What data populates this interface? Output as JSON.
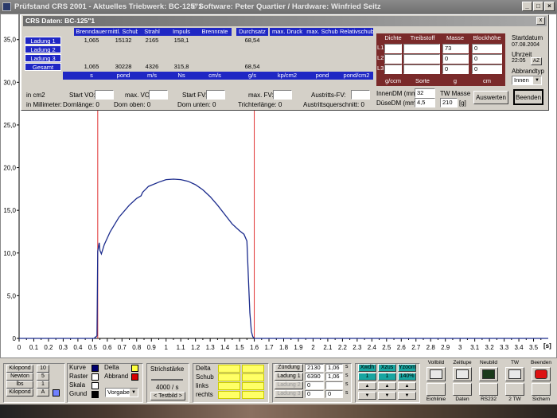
{
  "window": {
    "title_left": "Prüfstand CRS 2001 - Aktuelles Triebwerk: BC-125\"1",
    "title_right": "© Software: Peter Quartier / Hardware: Winfried Seitz",
    "min_glyph": "_",
    "max_glyph": "□",
    "close_glyph": "×"
  },
  "crs": {
    "title": "CRS Daten: BC-125\"1",
    "close_glyph": "x",
    "columns": [
      "Brenndauer",
      "mittl. Schub",
      "Strahl",
      "Impuls",
      "Brennrate",
      "Durchsatz",
      "max. Druck",
      "max. Schub",
      "Relativschub"
    ],
    "rows": [
      {
        "label": "Ladung 1",
        "values": [
          "1,065",
          "15132",
          "2165",
          "158,1",
          "",
          "68,54",
          "",
          "",
          ""
        ]
      },
      {
        "label": "Ladung 2",
        "values": [
          "",
          "",
          "",
          "",
          "",
          "",
          "",
          "",
          ""
        ]
      },
      {
        "label": "Ladung 3",
        "values": [
          "",
          "",
          "",
          "",
          "",
          "",
          "",
          "",
          ""
        ]
      },
      {
        "label": "Gesamt",
        "values": [
          "1,065",
          "30228",
          "4326",
          "315,8",
          "",
          "68,54",
          "",
          "",
          ""
        ]
      }
    ],
    "units": [
      "s",
      "pond",
      "m/s",
      "Ns",
      "cm/s",
      "g/s",
      "kp/cm2",
      "pond",
      "pond/cm2"
    ],
    "in_cm2": "in cm2",
    "in_mm": "in Millimeter:",
    "start_vo": "Start VO:",
    "max_vo": "max. VO:",
    "start_fv": "Start FV:",
    "max_fv": "max. FV:",
    "austritts_fv": "Austritts-FV:",
    "dornlaenge": "Dornlänge: 0",
    "dorn_oben": "Dorn oben: 0",
    "dorn_unten": "Dorn unten: 0",
    "trichterlaenge": "Trichterlänge: 0",
    "austrittsquerschnitt": "Austrittsquerschnitt: 0",
    "charge": {
      "headers": [
        "Dichte",
        "Treibstoff",
        "Masse",
        "Blockhöhe"
      ],
      "rows": [
        {
          "label": "L1",
          "dichte": "",
          "treibstoff": "",
          "masse": "73",
          "blockhoehe": "0"
        },
        {
          "label": "L2",
          "dichte": "",
          "treibstoff": "",
          "masse": "0",
          "blockhoehe": "0"
        },
        {
          "label": "L3",
          "dichte": "",
          "treibstoff": "",
          "masse": "0",
          "blockhoehe": "0"
        }
      ],
      "units": [
        "g/ccm",
        "Sorte",
        "g",
        "cm"
      ]
    },
    "innen_dm_label": "InnenDM (mm)",
    "innen_dm": "32",
    "duese_dm_label": "DüseDM (mm)",
    "duese_dm": "4,5",
    "tw_masse_label": "TW Masse",
    "tw_masse": "210",
    "tw_masse_unit": "[g]",
    "startdatum_label": "Startdatum",
    "startdatum": "07.08.2004",
    "uhrzeit_label": "Uhrzeit",
    "uhrzeit": "22:05",
    "az_button": "AZ",
    "abbrand_label": "Abbrandtyp",
    "abbrand_value": "Innen",
    "auswerten_button": "Auswerten",
    "beenden_button": "Beenden"
  },
  "chart_data": {
    "type": "line",
    "xlabel": "[s]",
    "x_ticks": [
      "0",
      "0.1",
      "0.2",
      "0.3",
      "0.4",
      "0.5",
      "0.6",
      "0.7",
      "0.8",
      "0.9",
      "1",
      "1.1",
      "1.2",
      "1.3",
      "1.4",
      "1.5",
      "1.6",
      "1.7",
      "1.8",
      "1.9",
      "2",
      "2.1",
      "2.2",
      "2.3",
      "2.4",
      "2.5",
      "2.6",
      "2.7",
      "2.8",
      "2.9",
      "3",
      "3.1",
      "3.2",
      "3.3",
      "3.4",
      "3.5"
    ],
    "y_ticks": [
      "0",
      "5,0",
      "10,0",
      "15,0",
      "20,0",
      "25,0",
      "30,0",
      "35,0"
    ],
    "xlim": [
      0,
      3.6
    ],
    "ylim": [
      0,
      36
    ],
    "marker_lines_x": [
      0.535,
      1.6
    ],
    "marker_color": "#e03030",
    "line_color": "#1a2a8c",
    "series": [
      {
        "x": [
          0,
          0.51,
          0.53,
          0.535,
          0.545,
          0.55,
          0.56,
          0.58,
          0.62,
          0.68,
          0.75,
          0.8,
          0.83,
          0.84,
          0.88,
          0.95,
          1.0,
          1.05,
          1.1,
          1.15,
          1.2,
          1.25,
          1.3,
          1.35,
          1.4,
          1.45,
          1.5,
          1.53,
          1.55,
          1.56,
          1.57,
          1.58,
          1.59,
          1.6,
          1.62,
          1.65,
          3.6
        ],
        "y": [
          0,
          0,
          0.3,
          10.2,
          11.2,
          10.3,
          9.9,
          11.0,
          12.5,
          14.2,
          15.6,
          16.4,
          16.7,
          17.1,
          17.8,
          18.3,
          18.6,
          18.65,
          18.6,
          18.4,
          18.0,
          17.4,
          16.6,
          15.6,
          14.5,
          13.4,
          12.6,
          12.2,
          11.4,
          7.0,
          3.0,
          0.8,
          0.2,
          0,
          0,
          0,
          0
        ]
      }
    ]
  },
  "bottom": {
    "units": [
      "Kilopond",
      "Newton",
      "lbs",
      "Kilopond"
    ],
    "unit_values": [
      "10",
      "5",
      "1",
      "A"
    ],
    "legend_labels": [
      "Kurve",
      "Raster",
      "Skala",
      "Grund"
    ],
    "legend_colors": [
      "#00006e",
      "#ffffff",
      "#ffffff",
      "#000000"
    ],
    "legend2_labels": [
      "Delta",
      "Abbrand"
    ],
    "legend2_colors": [
      "#ffff40",
      "#d40000"
    ],
    "vorgabe": "Vorgabe",
    "strichstaerke_label": "Strichstärke",
    "strichstaerke_value": "4000 / s",
    "testbild_label": "< Testbild >",
    "delta_labels": [
      "Delta",
      "Schub",
      "links",
      "rechts"
    ],
    "zuendung_rows": [
      {
        "label": "Zündung",
        "v1": "2130",
        "v2": "1,06",
        "unit": "s"
      },
      {
        "label": "Ladung 1",
        "v1": "6390",
        "v2": "1,06",
        "unit": "s"
      },
      {
        "label": "Ladung 2",
        "v1": "0",
        "v2": "",
        "unit": "s"
      },
      {
        "label": "Ladung 3",
        "v1": "0",
        "v2": "0",
        "unit": "s"
      }
    ],
    "zoom_buttons": [
      "Xwdh",
      "Xzus",
      "Yzoom"
    ],
    "zoom_values": [
      "1",
      "1",
      "140%"
    ],
    "icon_buttons": [
      {
        "top": "Vollbild",
        "bottom": "Eichlinie",
        "icon": "monitor-icon"
      },
      {
        "top": "Zeitlupe",
        "bottom": "Daten",
        "icon": "chart-icon"
      },
      {
        "top": "Neubild",
        "bottom": "RS232",
        "icon": "wave-icon"
      },
      {
        "top": "TW",
        "bottom": "2 TW",
        "icon": "rocket-icon"
      },
      {
        "top": "Beenden",
        "bottom": "Sichern",
        "icon": "stop-icon"
      }
    ]
  }
}
